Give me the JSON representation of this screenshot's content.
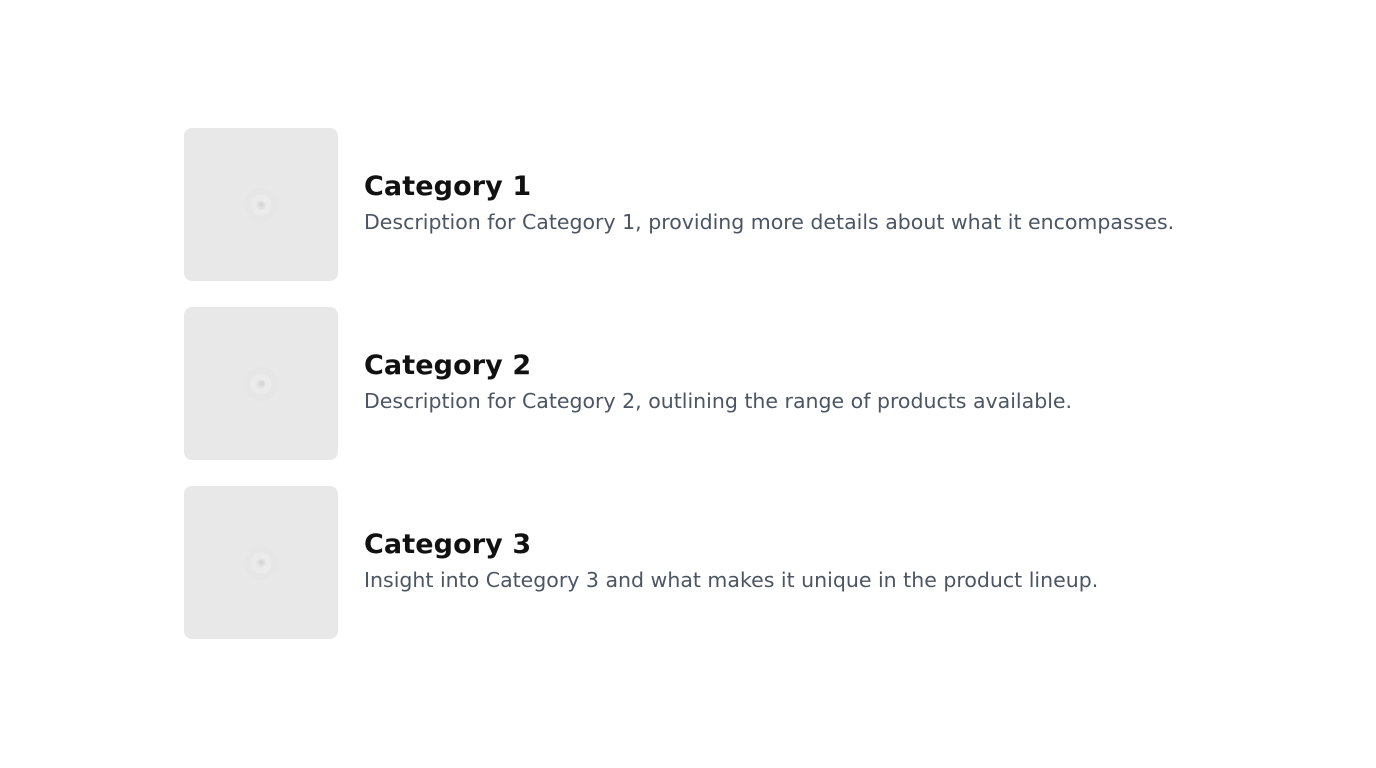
{
  "categories": [
    {
      "title": "Category 1",
      "description": "Description for Category 1, providing more details about what it encompasses.",
      "icon": "image-placeholder-icon"
    },
    {
      "title": "Category 2",
      "description": "Description for Category 2, outlining the range of products available.",
      "icon": "image-placeholder-icon"
    },
    {
      "title": "Category 3",
      "description": "Insight into Category 3 and what makes it unique in the product lineup.",
      "icon": "image-placeholder-icon"
    }
  ],
  "colors": {
    "background": "#ffffff",
    "thumbnail": "#e8e8e8",
    "title": "#111111",
    "description": "#4b5563"
  }
}
